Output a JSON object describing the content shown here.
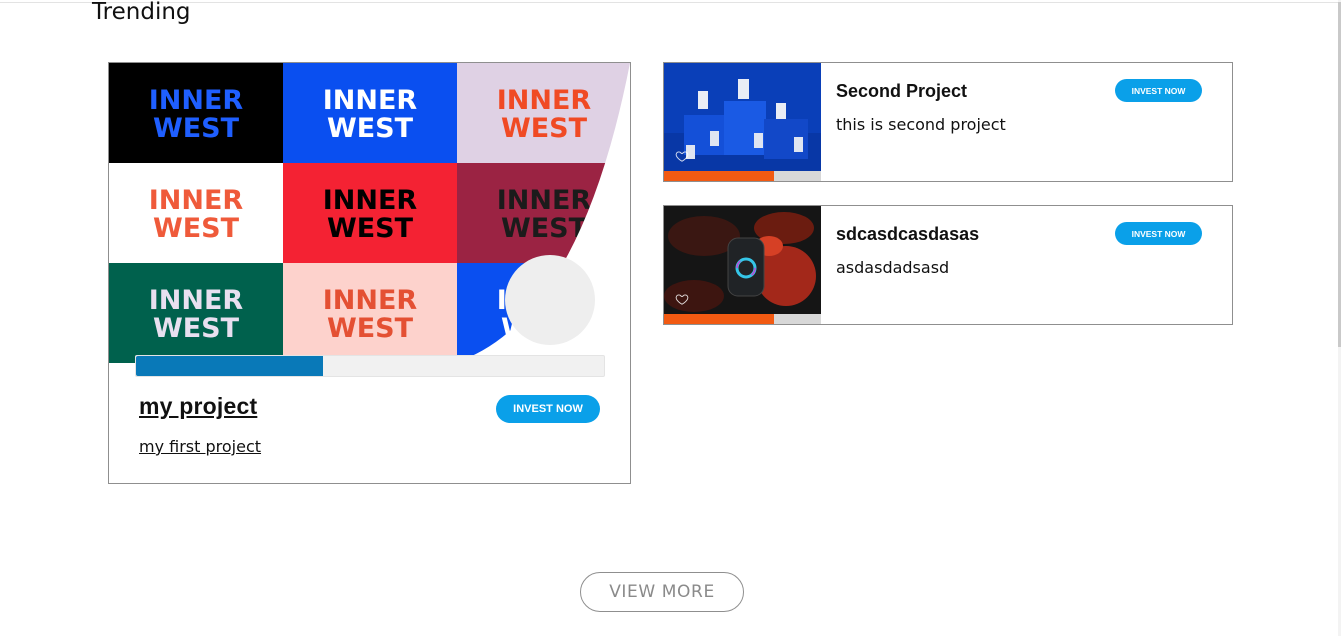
{
  "section": {
    "title": "Trending"
  },
  "featured": {
    "title": "my project",
    "description": "my first project",
    "invest_label": "INVEST NOW",
    "progress": 0.4,
    "image_tiles": [
      {
        "bg": "#000000",
        "text": "#1f5fff"
      },
      {
        "bg": "#0a4ff0",
        "text": "#ffffff"
      },
      {
        "bg": "#dfd1e4",
        "text": "#f04a24"
      },
      {
        "bg": "#ffffff",
        "text": "#ef5a3a"
      },
      {
        "bg": "#f42233",
        "text": "#000000"
      },
      {
        "bg": "#9b2343",
        "text": "#1b1b1b"
      },
      {
        "bg": "#00614d",
        "text": "#e8e0f0"
      },
      {
        "bg": "#fdd2cc",
        "text": "#e45033"
      },
      {
        "bg": "#0a4ff0",
        "text": "#ffffff"
      }
    ],
    "tile_word_top": "INNER",
    "tile_word_bottom": "WEST"
  },
  "projects": [
    {
      "title": "Second Project",
      "description": "this is second project",
      "invest_label": "INVEST NOW",
      "progress": 0.7,
      "thumb": "blue-cups"
    },
    {
      "title": "sdcasdcasdasas",
      "description": "asdasdadsasd",
      "invest_label": "INVEST NOW",
      "progress": 0.7,
      "thumb": "dark-device"
    }
  ],
  "view_more_label": "VIEW MORE",
  "colors": {
    "accent": "#0aa0e9",
    "progress_blue": "#0979b8",
    "progress_orange": "#f25a12"
  }
}
